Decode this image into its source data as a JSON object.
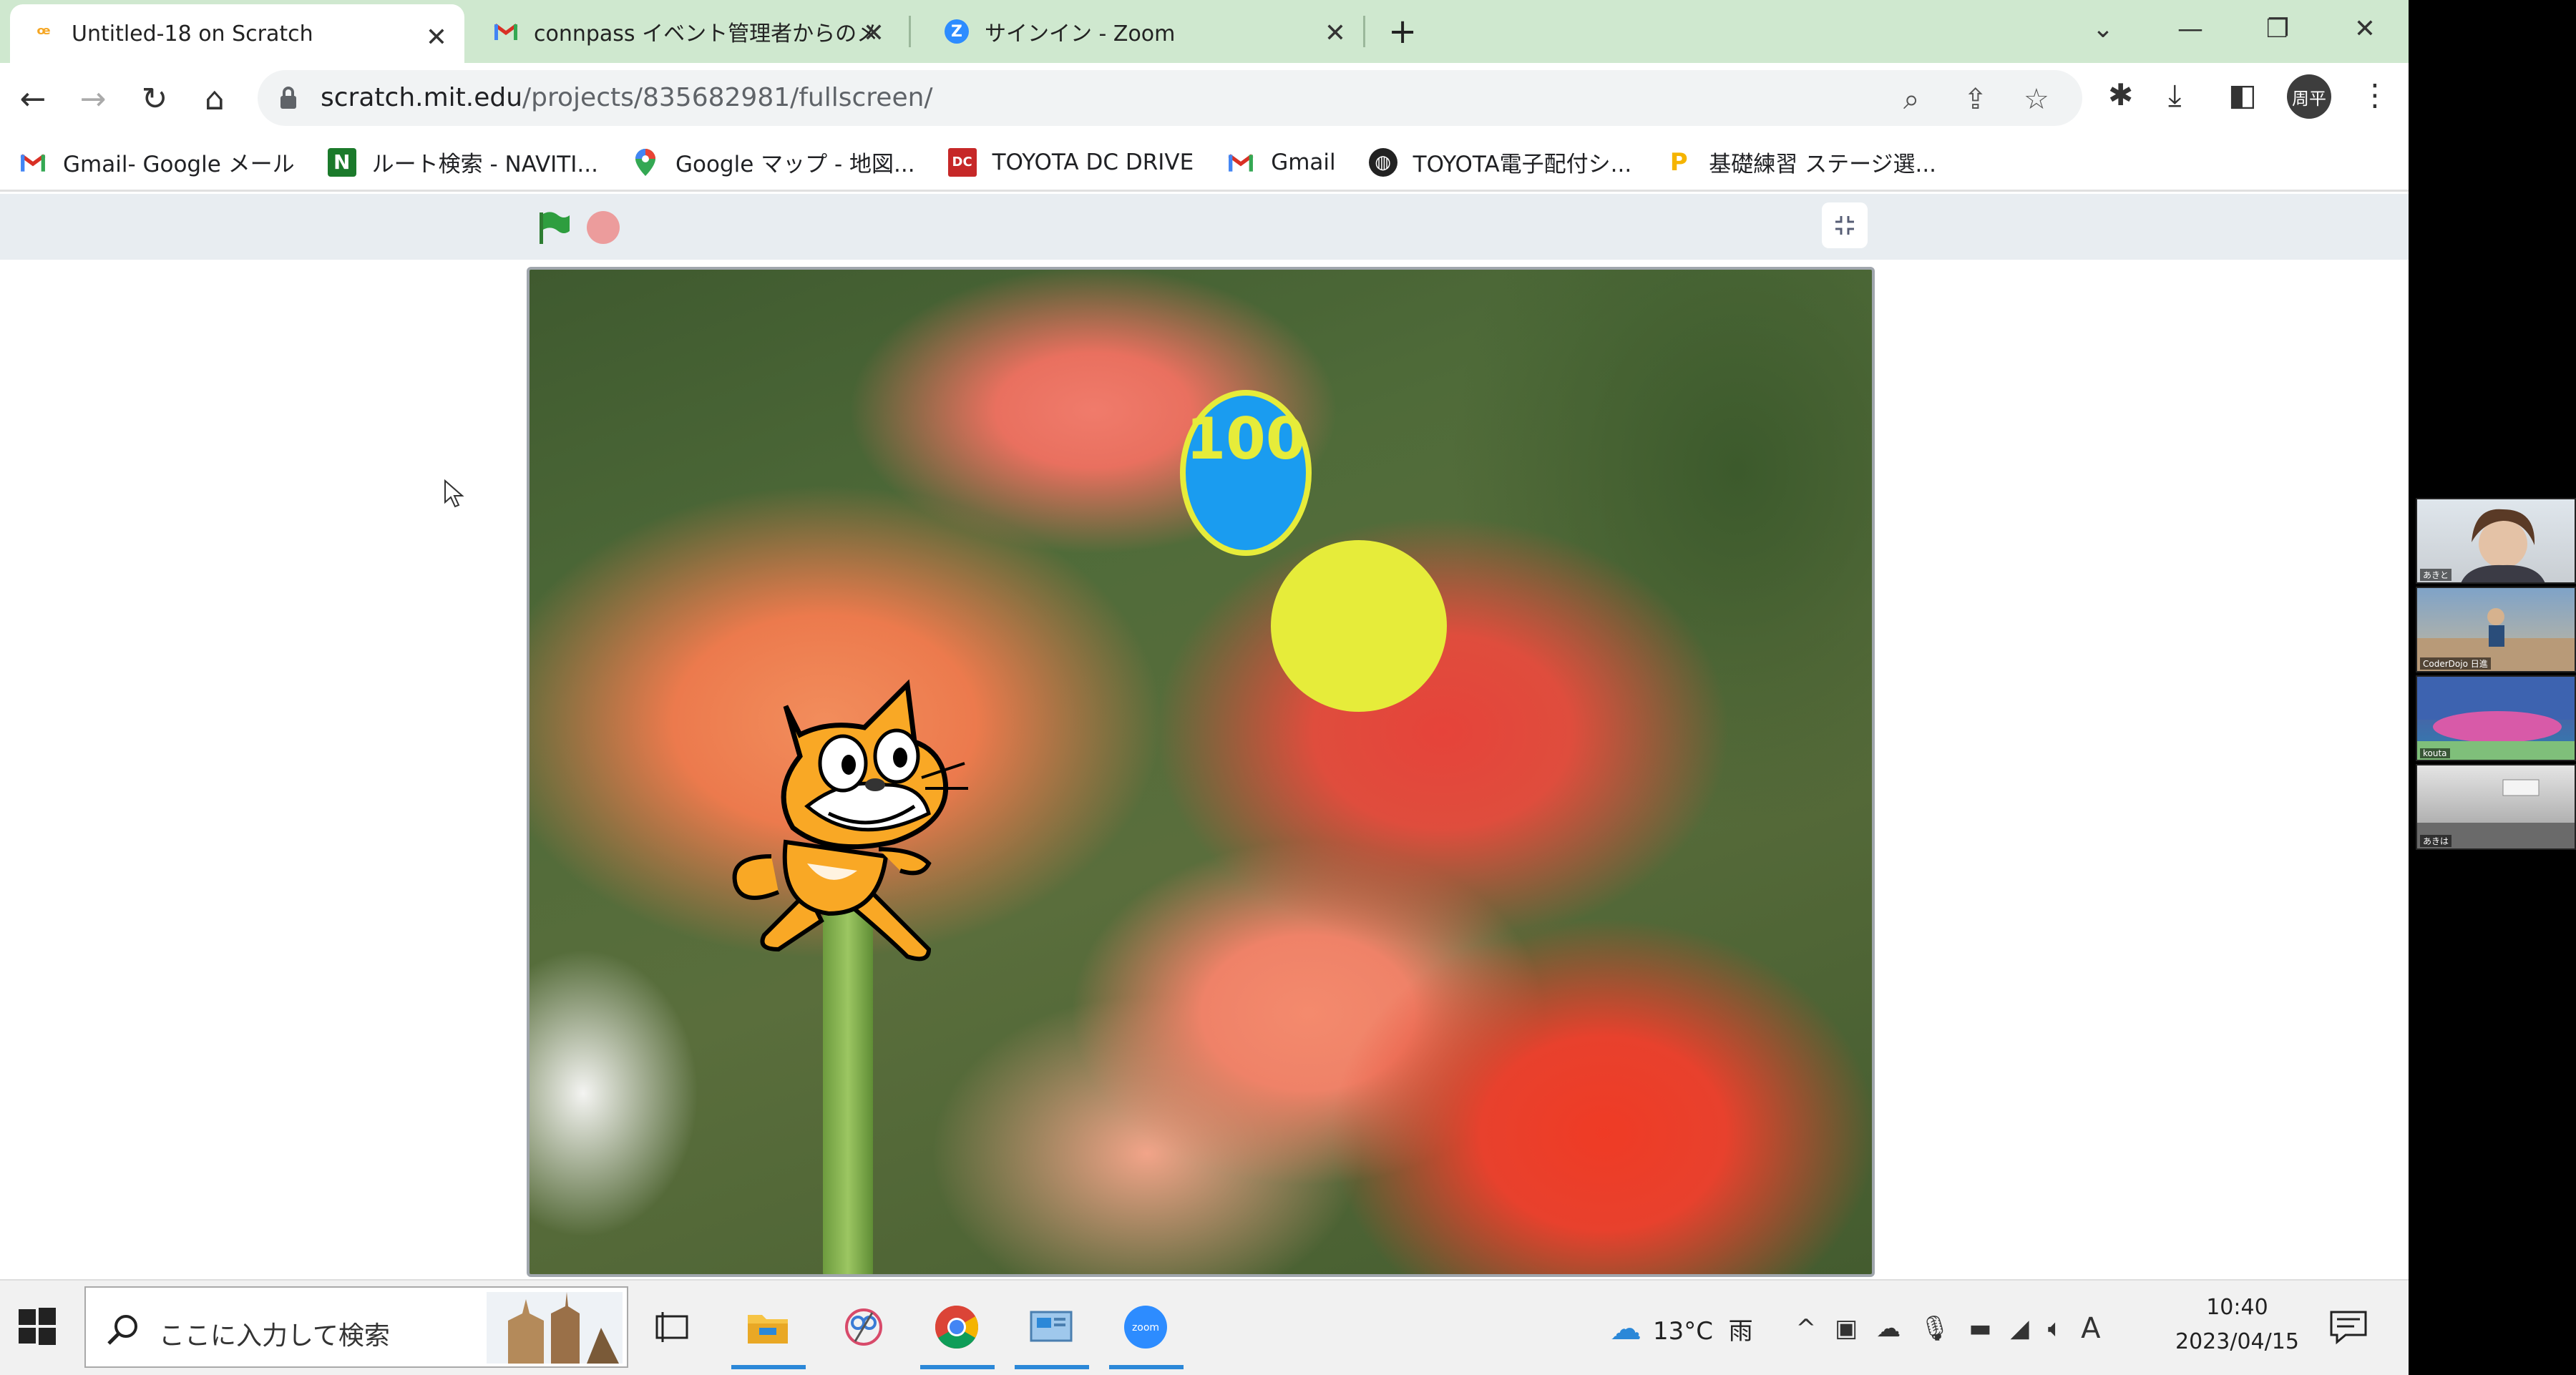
{
  "browser": {
    "tabs": [
      {
        "title": "Untitled-18 on Scratch",
        "favicon": "scratch-icon",
        "active": true
      },
      {
        "title": "connpass イベント管理者からのメッ",
        "favicon": "gmail-icon",
        "active": false
      },
      {
        "title": "サインイン - Zoom",
        "favicon": "zoom-icon",
        "active": false
      }
    ],
    "url_host": "scratch.mit.edu",
    "url_path": "/projects/835682981/fullscreen/",
    "profile_initials": "周平",
    "bookmarks": [
      {
        "label": "Gmail- Google メール",
        "icon": "gmail-icon"
      },
      {
        "label": "ルート検索 - NAVITI...",
        "icon": "navitime-icon"
      },
      {
        "label": "Google マップ - 地図...",
        "icon": "maps-pin-icon"
      },
      {
        "label": "TOYOTA DC DRIVE",
        "icon": "dc-icon"
      },
      {
        "label": "Gmail",
        "icon": "gmail-icon"
      },
      {
        "label": "TOYOTA電子配付シ...",
        "icon": "globe-icon"
      },
      {
        "label": "基礎練習 ステージ選...",
        "icon": "bookmark-p-icon"
      }
    ]
  },
  "scratch": {
    "score_value": "100",
    "colors": {
      "score_fill": "#1a9cf0",
      "score_border": "#e6ec3a",
      "ball": "#e6ec3a",
      "flag": "#2e9e3f",
      "stop": "#ec9c9c"
    }
  },
  "taskbar": {
    "search_placeholder": "ここに入力して検索",
    "weather": "13°C  雨",
    "ime": "A",
    "time": "10:40",
    "date": "2023/04/15"
  },
  "zoom": {
    "participants": [
      "あきと",
      "CoderDojo 日進",
      "kouta",
      "あきは"
    ]
  }
}
